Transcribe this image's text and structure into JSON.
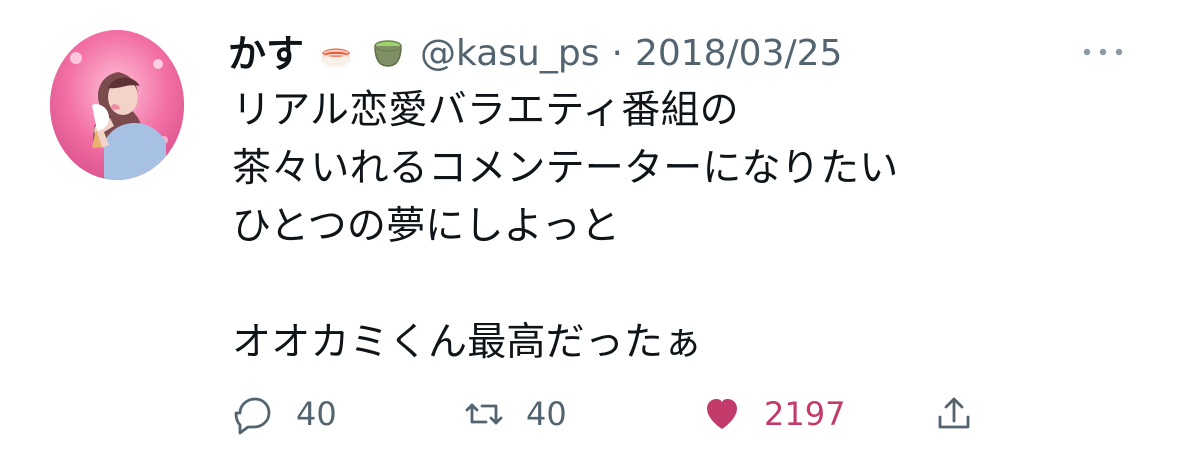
{
  "user": {
    "display_name": "かす",
    "emoji_1": "sushi-emoji",
    "emoji_2": "teacup-emoji",
    "handle": "@kasu_ps",
    "dot": "·",
    "date": "2018/03/25"
  },
  "tweet": {
    "text": "リアル恋愛バラエティ番組の\n茶々いれるコメンテーターになりたい\nひとつの夢にしよっと\n\nオオカミくん最高だったぁ"
  },
  "actions": {
    "reply_count": "40",
    "retweet_count": "40",
    "like_count": "2197"
  },
  "icons": {
    "more": "more-horizontal-icon",
    "reply": "reply-icon",
    "retweet": "retweet-icon",
    "like": "heart-icon",
    "share": "share-icon"
  },
  "colors": {
    "text": "#0f1419",
    "muted": "#536471",
    "like": "#c23b6b",
    "avatar_bg": "#ea5f96"
  }
}
